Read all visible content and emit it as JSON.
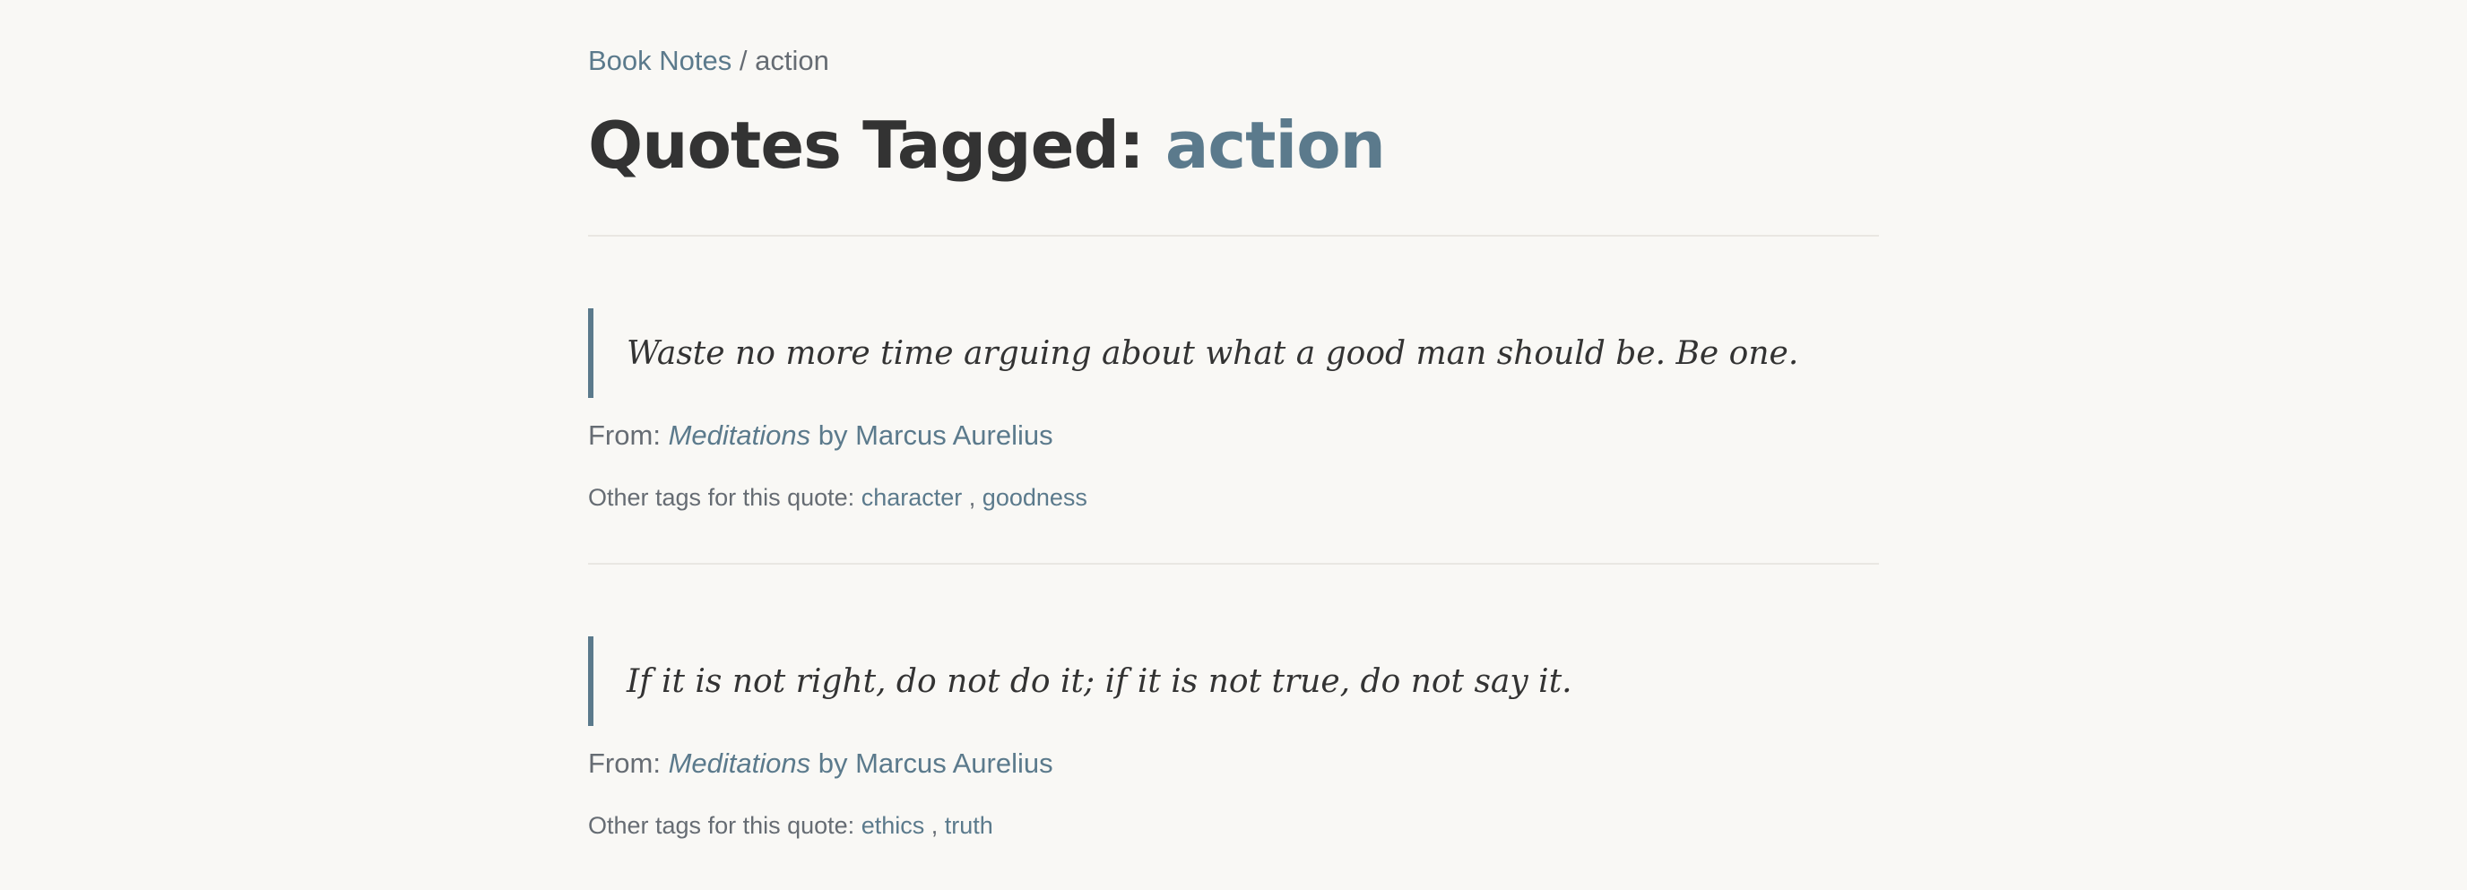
{
  "breadcrumb": {
    "home": "Book Notes",
    "separator": "/",
    "current": "action"
  },
  "header": {
    "title_prefix": "Quotes Tagged:",
    "tag": "action"
  },
  "quotes": [
    {
      "text": "Waste no more time arguing about what a good man should be. Be one.",
      "from_label": "From:",
      "book": "Meditations",
      "by_label": "by",
      "author": "Marcus Aurelius",
      "other_tags_label": "Other tags for this quote:",
      "tags": [
        "character",
        "goodness"
      ],
      "tag_separator": ","
    },
    {
      "text": "If it is not right, do not do it; if it is not true, do not say it.",
      "from_label": "From:",
      "book": "Meditations",
      "by_label": "by",
      "author": "Marcus Aurelius",
      "other_tags_label": "Other tags for this quote:",
      "tags": [
        "ethics",
        "truth"
      ],
      "tag_separator": ","
    }
  ],
  "colors": {
    "accent": "#5b7a8c",
    "text": "#333333",
    "muted": "#666c73",
    "background": "#f9f8f5",
    "divider": "#e9e7e2"
  }
}
